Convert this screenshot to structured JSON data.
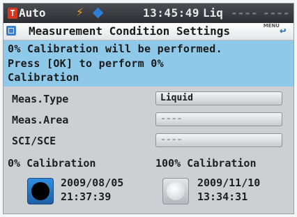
{
  "status_bar": {
    "mode": "Auto",
    "time": "13:45:49",
    "measure_mode": "Liq",
    "placeholders": [
      "----",
      "----"
    ]
  },
  "title_bar": {
    "title": "Measurement Condition Settings",
    "menu_label": "MENU"
  },
  "message": {
    "lines": [
      "0% Calibration will be performed.",
      "Press [OK] to perform 0%",
      "Calibration"
    ]
  },
  "settings": [
    {
      "label": "Meas.Type",
      "value": "Liquid"
    },
    {
      "label": "Meas.Area",
      "value": "----"
    },
    {
      "label": "SCI/SCE",
      "value": "----"
    }
  ],
  "calibration": {
    "zero": {
      "label": "0% Calibration",
      "date": "2009/08/05",
      "time": "21:37:39"
    },
    "hundred": {
      "label": "100% Calibration",
      "date": "2009/11/10",
      "time": "13:34:31"
    }
  },
  "icons": [
    "mode-icon",
    "battery-bolt-icon",
    "connection-icon",
    "settings-screen-icon",
    "back-icon"
  ],
  "colors": {
    "accent_blue": "#2f8ee0",
    "message_bg": "#8fc9ea",
    "status_bg": "#2c2e32",
    "mode_red": "#d8361e",
    "bolt_orange": "#f5a21b"
  }
}
